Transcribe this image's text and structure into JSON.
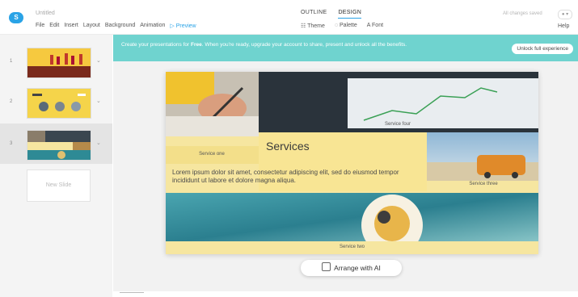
{
  "header": {
    "logo_letter": "S",
    "doc_title": "Untitled",
    "menu": [
      "File",
      "Edit",
      "Insert",
      "Layout",
      "Background",
      "Animation",
      "▷ Preview"
    ],
    "tabs": [
      {
        "label": "OUTLINE",
        "active": false
      },
      {
        "label": "DESIGN",
        "active": true
      }
    ],
    "tools": [
      "☷ Theme",
      "◌ Palette",
      "A Font"
    ],
    "save_status": "All changes saved",
    "help": "Help"
  },
  "sidebar": {
    "slides": [
      {
        "number": "1",
        "selected": false
      },
      {
        "number": "2",
        "selected": false
      },
      {
        "number": "3",
        "selected": true
      }
    ],
    "new_slide_label": "New Slide"
  },
  "banner": {
    "bold": "Free",
    "text_before": "Create your presentations for ",
    "text_after": ". When you're ready, upgrade your account to share, present and unlock all the benefits.",
    "button": "Unlock full experience"
  },
  "slide": {
    "title": "Services",
    "body": "Lorem ipsum dolor sit amet, consectetur adipiscing elit, sed do eiusmod tempor incididunt ut labore et dolore magna aliqua.",
    "captions": {
      "one": "Service one",
      "two": "Service two",
      "three": "Service three",
      "four": "Service four"
    }
  },
  "arrange_button": "Arrange with AI",
  "colors": {
    "accent": "#2aa3e6",
    "banner": "#6fd3cf",
    "slide_yellow": "#f6e6a0"
  }
}
